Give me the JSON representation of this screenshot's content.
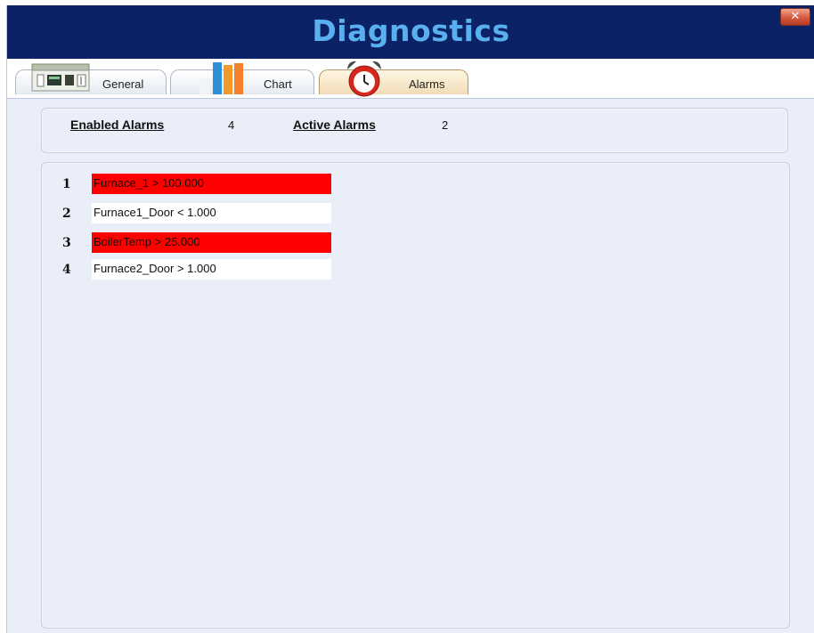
{
  "window": {
    "title": "Diagnostics",
    "close_label": "✕"
  },
  "tabs": [
    {
      "label": "General",
      "icon": "plc-module-icon",
      "active": false
    },
    {
      "label": "Chart",
      "icon": "bar-chart-icon",
      "active": false
    },
    {
      "label": "Alarms",
      "icon": "alarm-clock-icon",
      "active": true
    }
  ],
  "summary": {
    "enabled_label": "Enabled Alarms",
    "enabled_value": "4",
    "active_label": "Active Alarms",
    "active_value": "2"
  },
  "alarms": [
    {
      "number": "1",
      "expression": "Furnace_1 > 100.000",
      "active": true
    },
    {
      "number": "2",
      "expression": "Furnace1_Door < 1.000",
      "active": false
    },
    {
      "number": "3",
      "expression": "BoilerTemp > 25.000",
      "active": true
    },
    {
      "number": "4",
      "expression": "Furnace2_Door > 1.000",
      "active": false
    }
  ],
  "colors": {
    "title_bar": "#0b2366",
    "title_text": "#5ab0ef",
    "alarm_active": "#ff0000",
    "alarm_inactive": "#ffffff",
    "panel_bg": "#e9eef8"
  }
}
